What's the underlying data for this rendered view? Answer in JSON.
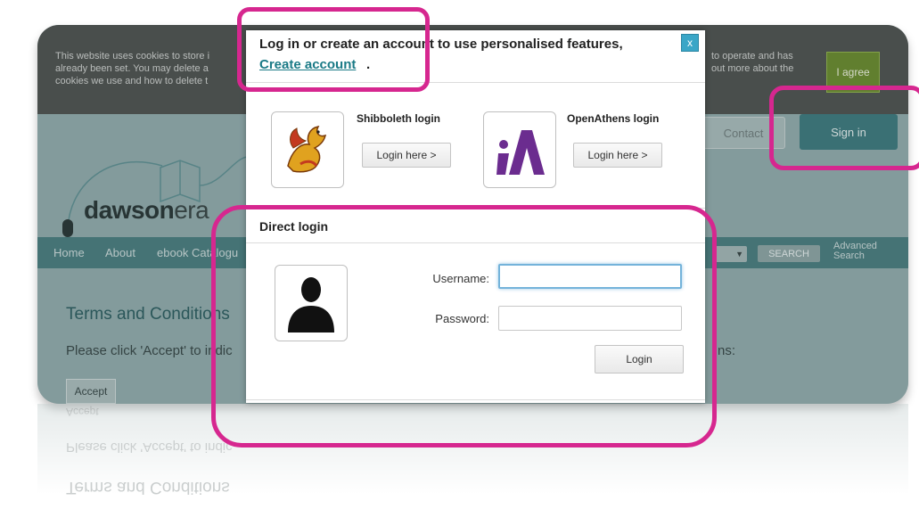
{
  "cookie_banner": {
    "text_left_1": "This website uses cookies to store i",
    "text_left_2": "already been set. You may delete a",
    "text_left_3": "cookies we use and how to delete t",
    "text_right_1": "to operate and has",
    "text_right_2": "out more about the",
    "agree_label": "I agree"
  },
  "header": {
    "contact_label": "Contact",
    "signin_label": "Sign in",
    "logo_bold": "dawson",
    "logo_light": "era"
  },
  "nav": {
    "items": [
      "Home",
      "About",
      "ebook Catalogu"
    ],
    "search_label": "SEARCH",
    "advanced_line1": "Advanced",
    "advanced_line2": "Search"
  },
  "page": {
    "terms_title": "Terms and Conditions",
    "terms_text": "Please click 'Accept' to indic",
    "terms_text_end": "ns:",
    "accept_label": "Accept"
  },
  "modal": {
    "title": "Log in or create an account to use personalised features,",
    "create_account_link": "Create account",
    "title_punct": ".",
    "close_label": "x",
    "shibboleth_title": "Shibboleth login",
    "shibboleth_button": "Login here >",
    "openathens_title": "OpenAthens login",
    "openathens_button": "Login here >",
    "direct_login_title": "Direct login",
    "username_label": "Username:",
    "password_label": "Password:",
    "username_value": "",
    "password_value": "",
    "login_button": "Login"
  },
  "colors": {
    "highlight": "#d6278f",
    "link": "#1a7a86",
    "close_button": "#3aa6c7",
    "navbar": "#4b7d7f"
  }
}
